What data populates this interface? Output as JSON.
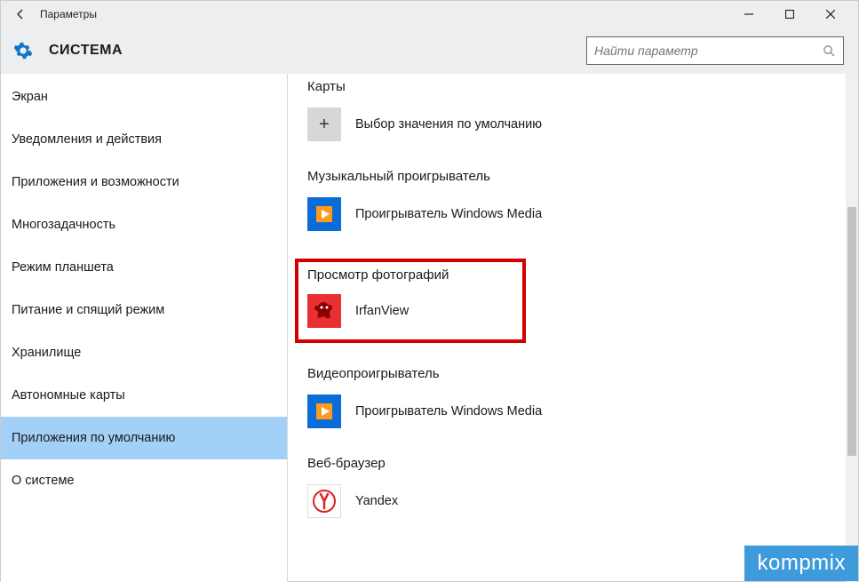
{
  "titlebar": {
    "title": "Параметры"
  },
  "header": {
    "page_title": "СИСТЕМА",
    "search_placeholder": "Найти параметр"
  },
  "sidebar": {
    "items": [
      {
        "label": "Экран",
        "selected": false
      },
      {
        "label": "Уведомления и действия",
        "selected": false
      },
      {
        "label": "Приложения и возможности",
        "selected": false
      },
      {
        "label": "Многозадачность",
        "selected": false
      },
      {
        "label": "Режим планшета",
        "selected": false
      },
      {
        "label": "Питание и спящий режим",
        "selected": false
      },
      {
        "label": "Хранилище",
        "selected": false
      },
      {
        "label": "Автономные карты",
        "selected": false
      },
      {
        "label": "Приложения по умолчанию",
        "selected": true
      },
      {
        "label": "О системе",
        "selected": false
      }
    ]
  },
  "content": {
    "sections": [
      {
        "title": "Карты",
        "app": "Выбор значения по умолчанию",
        "icon": "plus"
      },
      {
        "title": "Музыкальный проигрыватель",
        "app": "Проигрыватель Windows Media",
        "icon": "wmp"
      },
      {
        "title": "Просмотр фотографий",
        "app": "IrfanView",
        "icon": "irfan",
        "highlighted": true
      },
      {
        "title": "Видеопроигрыватель",
        "app": "Проигрыватель Windows Media",
        "icon": "wmp2"
      },
      {
        "title": "Веб-браузер",
        "app": "Yandex",
        "icon": "yandex"
      }
    ]
  },
  "watermark": "kompmix"
}
